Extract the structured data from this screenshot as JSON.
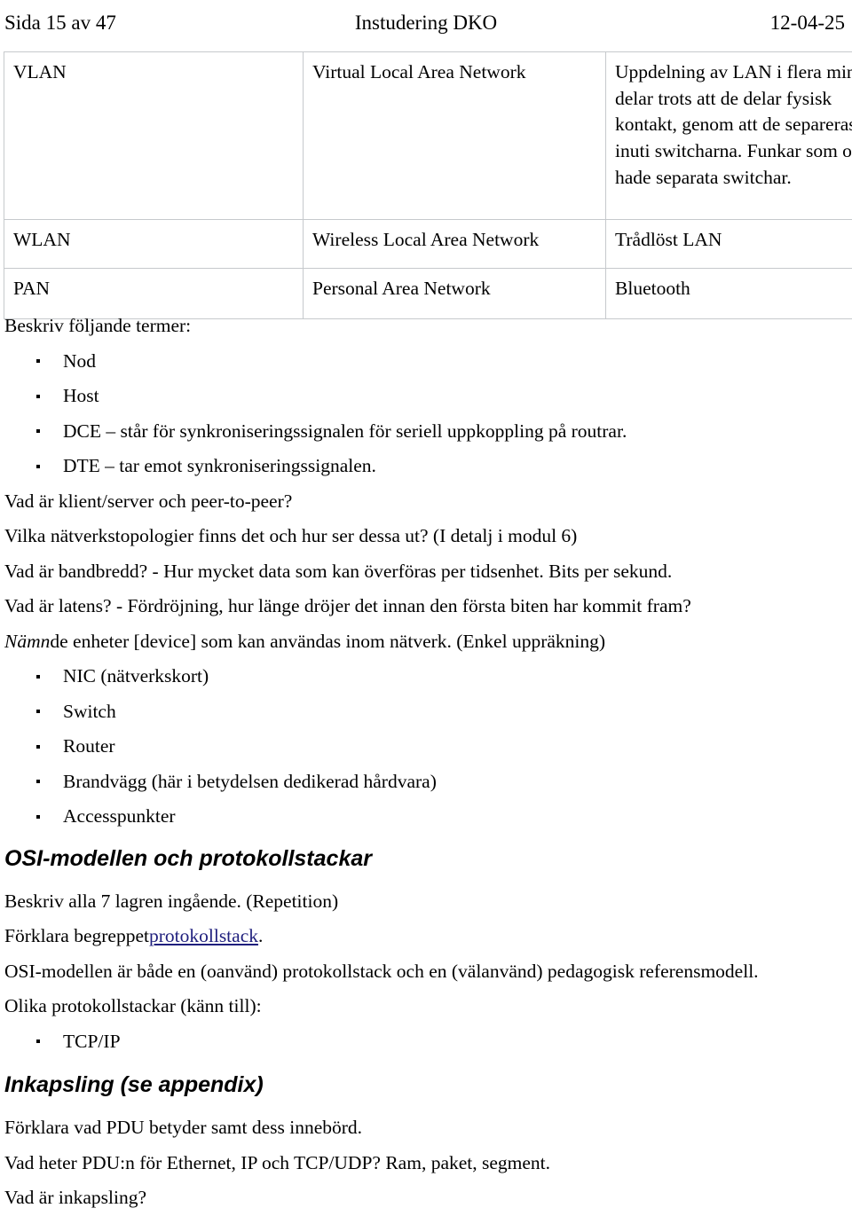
{
  "header": {
    "left": "Sida 15 av 47",
    "center": "Instudering DKO",
    "right": "12-04-25"
  },
  "table": {
    "rows": [
      {
        "abbr": "VLAN",
        "expansion": "Virtual Local Area Network",
        "description": "Uppdelning av LAN i flera mindre delar trots att de delar fysisk kontakt, genom att de separeras inuti switcharna. Funkar som om de hade separata switchar."
      },
      {
        "abbr": "WLAN",
        "expansion": "Wireless Local Area Network",
        "description": "Trådlöst LAN"
      },
      {
        "abbr": "PAN",
        "expansion": "Personal Area Network",
        "description": "Bluetooth"
      }
    ]
  },
  "body": {
    "terms_intro": "Beskriv följande termer:",
    "terms_bullets": [
      "Nod",
      "Host",
      "DCE – står för synkroniseringssignalen för seriell uppkoppling på routrar.",
      "DTE – tar emot synkroniseringssignalen."
    ],
    "questions": [
      "Vad är klient/server och peer-to-peer?",
      "Vilka nätverkstopologier finns det och hur ser dessa ut? (I detalj i modul 6)",
      "Vad är bandbredd? - Hur mycket data som kan överföras per tidsenhet. Bits per sekund.",
      "Vad är latens? - Fördröjning, hur länge dröjer det innan den första biten har kommit fram?"
    ],
    "devices_intro_italic": "Nämn",
    "devices_intro_rest": " de enheter [device] som kan användas inom nätverk. (Enkel uppräkning)",
    "devices_bullets": [
      "NIC (nätverkskort)",
      "Switch",
      "Router",
      "Brandvägg (här i betydelsen dedikerad hårdvara)",
      "Accesspunkter"
    ]
  },
  "osi_section": {
    "heading": "OSI-modellen och protokollstackar",
    "line_repetition": "Beskriv alla 7 lagren ingående. (Repetition)",
    "link_line_prefix": "Förklara begreppet ",
    "link_text": "protokollstack",
    "link_line_suffix": ".",
    "line_refmodel": "OSI-modellen är både en (oanvänd) protokollstack och en (välanvänd) pedagogisk referensmodell.",
    "line_stacks_intro": "Olika protokollstackar (känn till):",
    "stack_bullets": [
      "TCP/IP"
    ]
  },
  "inkapsling_section": {
    "heading": "Inkapsling (se appendix)",
    "lines": [
      "Förklara vad PDU betyder samt dess innebörd.",
      "Vad heter PDU:n för Ethernet, IP och TCP/UDP? Ram, paket, segment.",
      "Vad är inkapsling?"
    ]
  },
  "colors": {
    "text": "#000000",
    "link": "#1f1f7d",
    "table_border": "#c6c9cc",
    "page_background": "#ffffff"
  }
}
